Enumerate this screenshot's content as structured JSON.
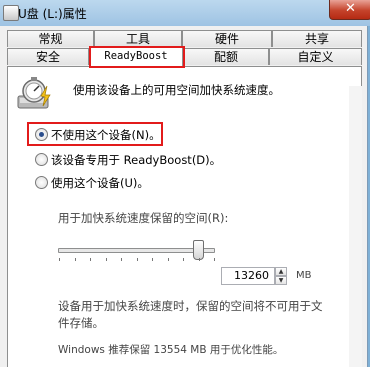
{
  "window": {
    "title": "U盘 (L:)属性",
    "close_glyph": "✕"
  },
  "tabs_top": [
    "常规",
    "工具",
    "硬件",
    "共享"
  ],
  "tabs_bottom": [
    "安全",
    "ReadyBoost",
    "配额",
    "自定义"
  ],
  "active_tab": "ReadyBoost",
  "readyboost": {
    "description": "使用该设备上的可用空间加快系统速度。",
    "options": [
      {
        "label": "不使用这个设备(N)。",
        "checked": true
      },
      {
        "label": "该设备专用于 ReadyBoost(D)。",
        "checked": false
      },
      {
        "label": "使用这个设备(U)。",
        "checked": false
      }
    ],
    "reserve_label": "用于加快系统速度保留的空间(R):",
    "reserve_value": "13260",
    "reserve_unit": "MB",
    "slider_fraction": 0.9,
    "info_line1": "设备用于加快系统速度时，保留的空间将不可用于文",
    "info_line2": "件存储。",
    "recommend": "Windows 推荐保留 13554 MB 用于优化性能。"
  },
  "accent_color": "#e21b1b",
  "icons": [
    "readyboost-icon",
    "close-icon"
  ]
}
